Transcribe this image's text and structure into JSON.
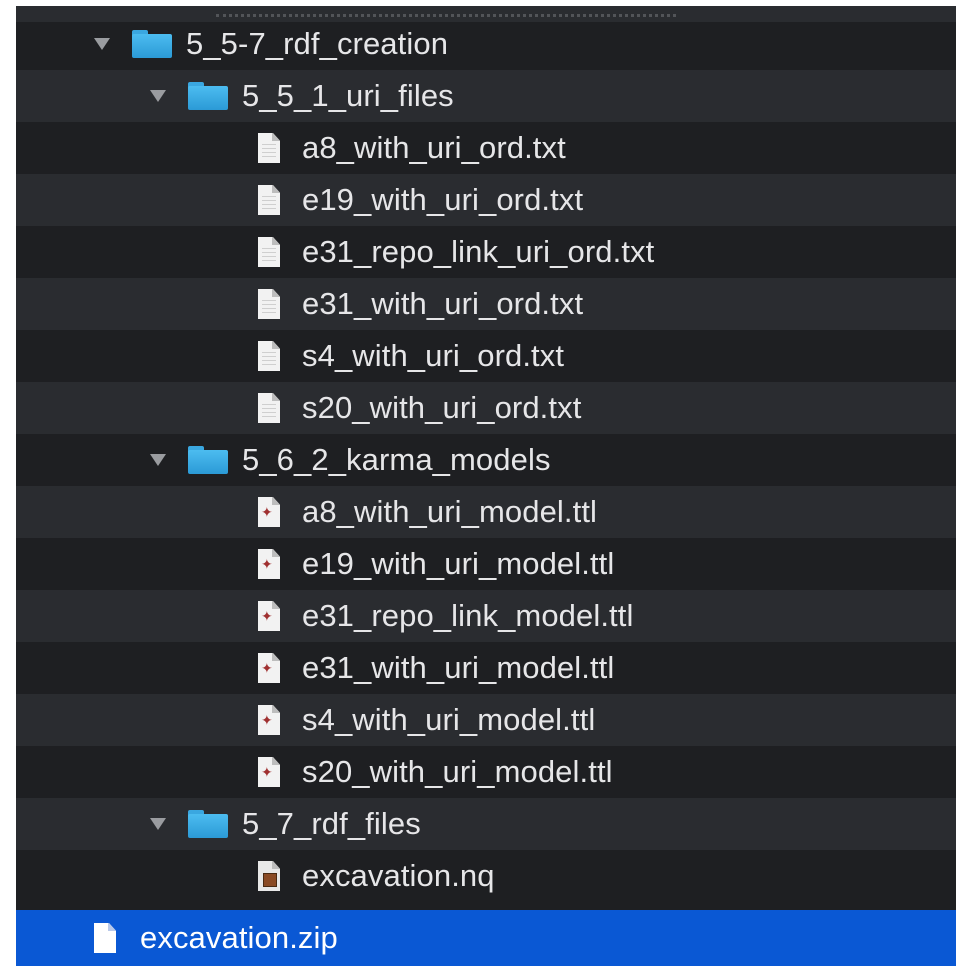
{
  "tree": {
    "root_folder": {
      "name": "5_5-7_rdf_creation",
      "expanded": true
    },
    "uri_files_folder": {
      "name": "5_5_1_uri_files",
      "expanded": true,
      "files": [
        "a8_with_uri_ord.txt",
        "e19_with_uri_ord.txt",
        "e31_repo_link_uri_ord.txt",
        "e31_with_uri_ord.txt",
        "s4_with_uri_ord.txt",
        "s20_with_uri_ord.txt"
      ]
    },
    "karma_models_folder": {
      "name": "5_6_2_karma_models",
      "expanded": true,
      "files": [
        "a8_with_uri_model.ttl",
        "e19_with_uri_model.ttl",
        "e31_repo_link_model.ttl",
        "e31_with_uri_model.ttl",
        "s4_with_uri_model.ttl",
        "s20_with_uri_model.ttl"
      ]
    },
    "rdf_files_folder": {
      "name": "5_7_rdf_files",
      "expanded": true,
      "files": [
        "excavation.nq"
      ]
    },
    "selected_file": {
      "name": "excavation.zip"
    }
  },
  "icons": {
    "folder": "folder-icon",
    "text_file": "text-file-icon",
    "ttl_file": "ttl-file-icon",
    "nq_file": "nq-file-icon",
    "zip_file": "zip-file-icon",
    "disclosure": "disclosure-triangle-icon"
  },
  "colors": {
    "background": "#1e1f22",
    "alternate_row": "#2a2c30",
    "selection": "#0a58d4",
    "folder": "#3aa7e0",
    "text": "#e6e6e8"
  }
}
